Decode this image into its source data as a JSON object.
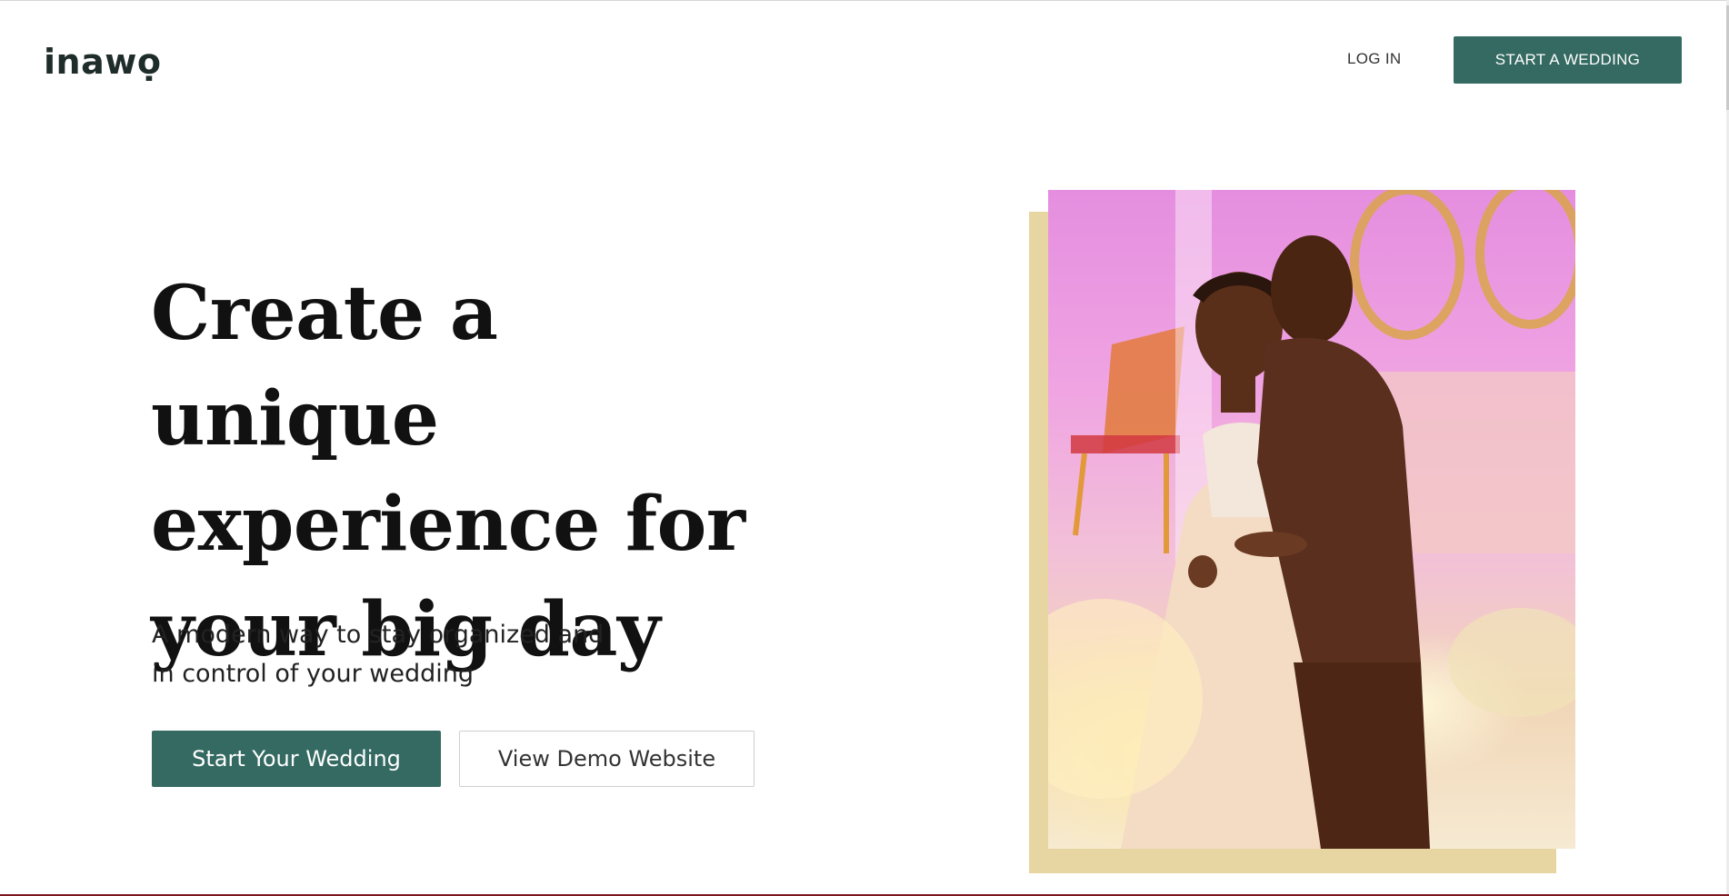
{
  "brand": {
    "logo_text": "inawọ"
  },
  "nav": {
    "login_label": "LOG IN",
    "start_wedding_label": "START A WEDDING"
  },
  "hero": {
    "title_line_1": "Create a unique",
    "title_line_2": "experience for",
    "title_line_3": "your big day",
    "subtitle_line_1": "A modern way to stay organized and",
    "subtitle_line_2": "in control of your wedding",
    "primary_button_label": "Start Your Wedding",
    "secondary_button_label": "View Demo Website",
    "image_alt": "Bride and groom dancing at their wedding reception"
  },
  "colors": {
    "accent": "#346a62",
    "photo_frame": "#e8d6a2",
    "text": "#111111"
  }
}
